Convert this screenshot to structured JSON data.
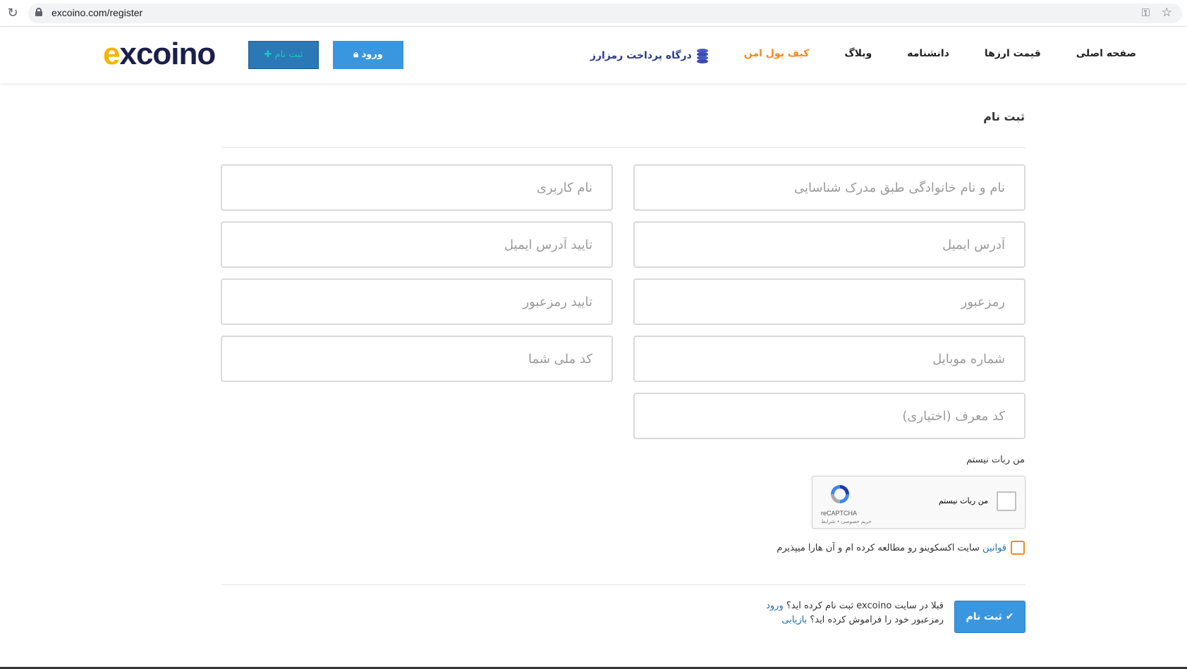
{
  "browser": {
    "url": "excoino.com/register"
  },
  "header": {
    "logo": {
      "prefix": "e",
      "rest": "xcoino"
    },
    "register_button": "ثبت نام",
    "login_button": "ورود",
    "nav": [
      {
        "label": "صفحه اصلی"
      },
      {
        "label": "قیمت ارزها"
      },
      {
        "label": "دانشنامه"
      },
      {
        "label": "وبلاگ"
      },
      {
        "label": "کیف پول امن"
      },
      {
        "label": "درگاه پرداخت رمزارز"
      }
    ]
  },
  "form": {
    "title": "ثبت نام",
    "fields": {
      "full_name": {
        "placeholder": "نام و نام خانوادگی طبق مدرک شناسایی",
        "value": ""
      },
      "username": {
        "placeholder": "نام کاربری",
        "value": ""
      },
      "email": {
        "placeholder": "آدرس ایمیل",
        "value": ""
      },
      "email_confirm": {
        "placeholder": "تایید آدرس ایمیل",
        "value": ""
      },
      "password": {
        "placeholder": "رمزعبور",
        "value": ""
      },
      "password_confirm": {
        "placeholder": "تایید رمزعبور",
        "value": ""
      },
      "mobile": {
        "placeholder": "شماره موبایل",
        "value": ""
      },
      "national_id": {
        "placeholder": "کد ملی شما",
        "value": ""
      },
      "referral": {
        "placeholder": "کد معرف (اختیاری)",
        "value": ""
      }
    },
    "robot_label": "من ربات نیستم",
    "recaptcha": {
      "check_text": "من ربات نیستم",
      "brand": "reCAPTCHA",
      "terms": "حریم خصوصی • شرایط"
    },
    "terms": {
      "link": "قوانین",
      "text": " سایت اکسکوینو رو مطالعه کرده ام و آن هارا میپذیرم"
    },
    "submit_button": "ثبت نام",
    "already_registered": "قبلا در سایت excoino ثبت نام کرده اید؟",
    "login_link": "ورود",
    "forgot_password": "رمزعبور خود را فراموش کرده اید؟",
    "recover_link": "بازیابی"
  },
  "colors": {
    "accent_blue": "#3a97df",
    "accent_orange": "#f28a1f",
    "logo_yellow": "#f5b400",
    "logo_navy": "#1b1f4b"
  }
}
